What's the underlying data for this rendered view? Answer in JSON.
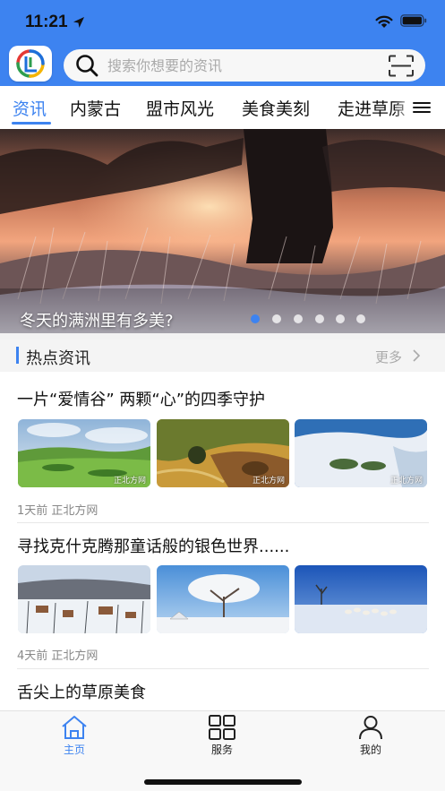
{
  "status_bar": {
    "time": "11:21"
  },
  "search": {
    "placeholder": "搜索你想要的资讯"
  },
  "tabs": [
    {
      "label": "资讯",
      "active": true
    },
    {
      "label": "内蒙古",
      "active": false
    },
    {
      "label": "盟市风光",
      "active": false
    },
    {
      "label": "美食美刻",
      "active": false
    },
    {
      "label": "走进草原",
      "active": false
    }
  ],
  "banner": {
    "caption": "冬天的满洲里有多美?",
    "slide_count": 6,
    "active_slide": 1
  },
  "section": {
    "title": "热点资讯",
    "more_label": "更多"
  },
  "articles": [
    {
      "title": "一片“爱情谷” 两颗“心”的四季守护",
      "meta": "1天前  正北方网",
      "watermarks": [
        "正北方网",
        "正北方网",
        "正北方网"
      ]
    },
    {
      "title": "寻找克什克腾那童话般的银色世界......",
      "meta": "4天前  正北方网",
      "watermarks": [
        "",
        "",
        ""
      ]
    },
    {
      "title": "舌尖上的草原美食"
    }
  ],
  "tabbar": [
    {
      "label": "主页",
      "icon": "home-icon",
      "active": true
    },
    {
      "label": "服务",
      "icon": "grid-icon",
      "active": false
    },
    {
      "label": "我的",
      "icon": "profile-icon",
      "active": false
    }
  ],
  "colors": {
    "accent": "#3d83f0",
    "header_bg": "#3d83f0"
  }
}
